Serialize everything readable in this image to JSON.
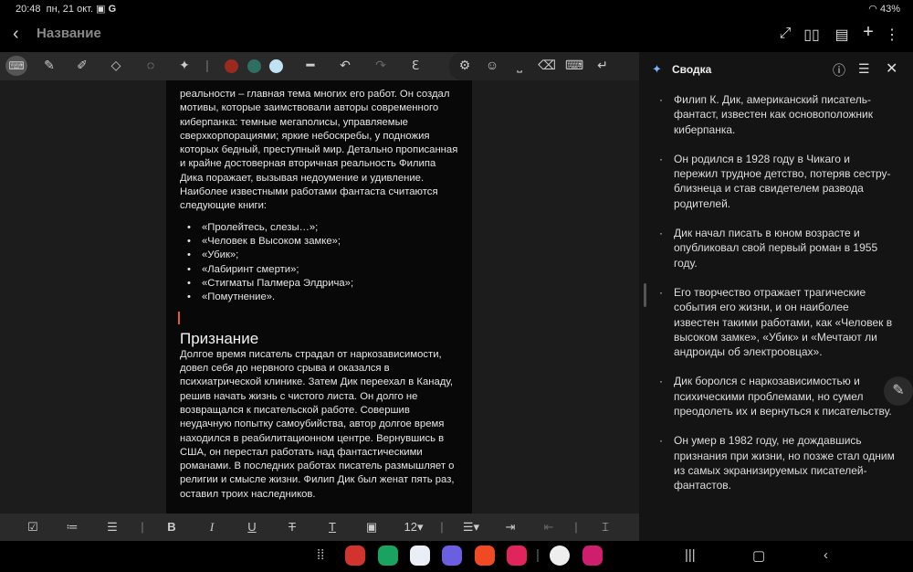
{
  "status": {
    "time": "20:48",
    "date": "пн, 21 окт.",
    "battery": "43%"
  },
  "header": {
    "title": "Название"
  },
  "toolbar": {
    "colors": [
      "#9a2a1f",
      "#2f6e62",
      "#bfe3f2"
    ]
  },
  "note": {
    "intro": "реальности – главная тема многих его работ. Он создал мотивы, которые заимствовали авторы современного киберпанка: темные мегаполисы, управляемые сверхкорпорациями; яркие небоскребы, у подножия которых бедный, преступный мир. Детально прописанная и крайне достоверная вторичная реальность Филипа Дика поражает, вызывая недоумение и удивление. Наиболее известными работами фантаста считаются следующие книги:",
    "books": [
      "«Пролейтесь, слезы…»;",
      "«Человек в Высоком замке»;",
      "«Убик»;",
      "«Лабиринт смерти»;",
      "«Стигматы Палмера Элдрича»;",
      "«Помутнение»."
    ],
    "heading": "Признание",
    "body": "Долгое время писатель страдал от наркозависимости, довел себя до нервного срыва и оказался в психиатрической клинике. Затем Дик переехал в Канаду, решив начать жизнь с чистого листа. Он долго не возвращался к писательской работе. Совершив неудачную попытку самоубийства, автор долгое время находился в реабилитационном центре. Вернувшись в США, он перестал работать над фантастическими романами. В последних работах писатель размышляет о религии и смысле жизни. Филип Дик был женат пять раз, оставил троих наследников."
  },
  "format": {
    "font_size": "12"
  },
  "summary": {
    "title": "Сводка",
    "items": [
      "Филип К. Дик, американский писатель-фантаст, известен как основоположник киберпанка.",
      "Он родился в 1928 году в Чикаго и пережил трудное детство, потеряв сестру-близнеца и став свидетелем развода родителей.",
      "Дик начал писать в юном возрасте и опубликовал свой первый роман в 1955 году.",
      "Его творчество отражает трагические события его жизни, и он наиболее известен такими работами, как «Человек в высоком замке», «Убик» и «Мечтают ли андроиды об электроовцах».",
      "Дик боролся с наркозависимостью и психическими проблемами, но сумел преодолеть их и вернуться к писательству.",
      "Он умер в 1982 году, не дождавшись признания при жизни, но позже стал одним из самых экранизируемых писателей-фантастов."
    ]
  }
}
